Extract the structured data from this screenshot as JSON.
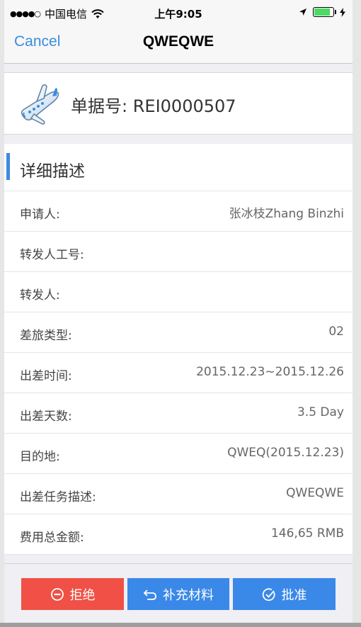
{
  "status_bar": {
    "signal": "●●●●○",
    "carrier": "中国电信",
    "time": "上午9:05"
  },
  "nav": {
    "cancel_label": "Cancel",
    "title": "QWEQWE"
  },
  "header": {
    "icon": "airplane-icon",
    "doc_label": "单据号:",
    "doc_number": "REI0000507"
  },
  "section": {
    "title": "详细描述",
    "accent_color": "#3a8ce0"
  },
  "rows": [
    {
      "label": "申请人:",
      "value": "张冰枝Zhang Binzhi"
    },
    {
      "label": "转发人工号:",
      "value": ""
    },
    {
      "label": "转发人:",
      "value": ""
    },
    {
      "label": "差旅类型:",
      "value": "02"
    },
    {
      "label": "出差时间:",
      "value": "2015.12.23~2015.12.26"
    },
    {
      "label": "出差天数:",
      "value": "3.5 Day"
    },
    {
      "label": "目的地:",
      "value": "QWEQ(2015.12.23)"
    },
    {
      "label": "出差任务描述:",
      "value": "QWEQWE"
    },
    {
      "label": "费用总金额:",
      "value": "146,65 RMB"
    }
  ],
  "actions": {
    "reject_label": "拒绝",
    "supplement_label": "补充材料",
    "approve_label": "批准",
    "reject_color": "#f05046",
    "primary_color": "#3a88e8"
  }
}
